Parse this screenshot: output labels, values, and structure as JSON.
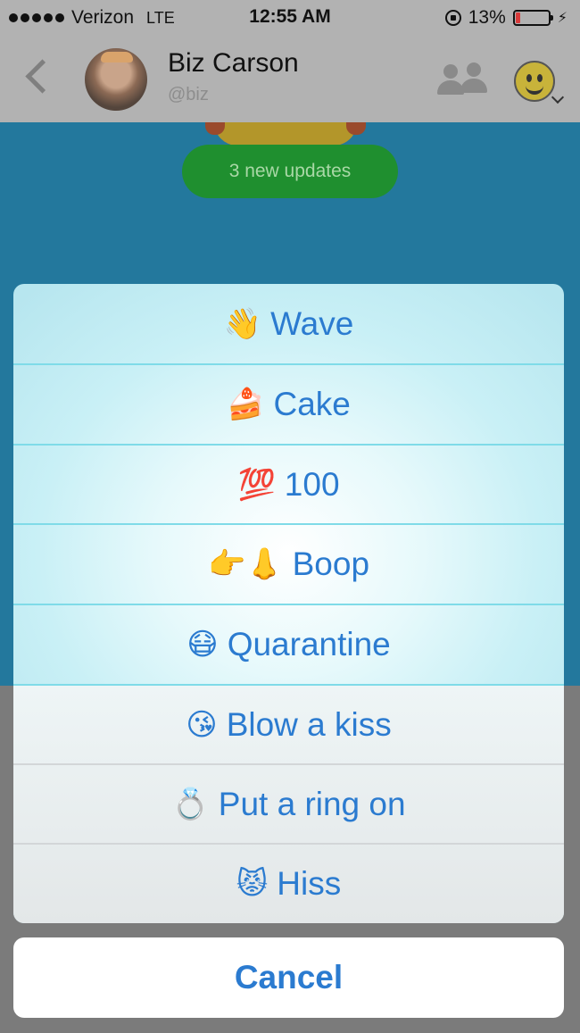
{
  "status_bar": {
    "carrier": "Verizon",
    "network": "LTE",
    "time": "12:55 AM",
    "battery_percent": "13%",
    "battery_level": 0.13,
    "battery_color": "#d93b3b"
  },
  "header": {
    "name": "Biz Carson",
    "handle": "@biz",
    "icons": [
      "back-icon",
      "group-icon",
      "emoji-picker-icon"
    ]
  },
  "chat": {
    "updates_label": "3 new updates"
  },
  "action_sheet": {
    "items": [
      {
        "emoji": "👋",
        "label": "Wave"
      },
      {
        "emoji": "🍰",
        "label": "Cake"
      },
      {
        "emoji": "💯",
        "label": "100"
      },
      {
        "emoji": "👉👃",
        "label": "Boop"
      },
      {
        "emoji": "😷",
        "label": "Quarantine"
      },
      {
        "emoji": "😘",
        "label": "Blow a kiss"
      },
      {
        "emoji": "💍",
        "label": "Put a ring on"
      },
      {
        "emoji": "😾",
        "label": "Hiss"
      }
    ],
    "cancel_label": "Cancel"
  },
  "colors": {
    "accent": "#2b7bd0",
    "chat_background": "#23789d",
    "updates_pill": "#1f8f2f"
  }
}
